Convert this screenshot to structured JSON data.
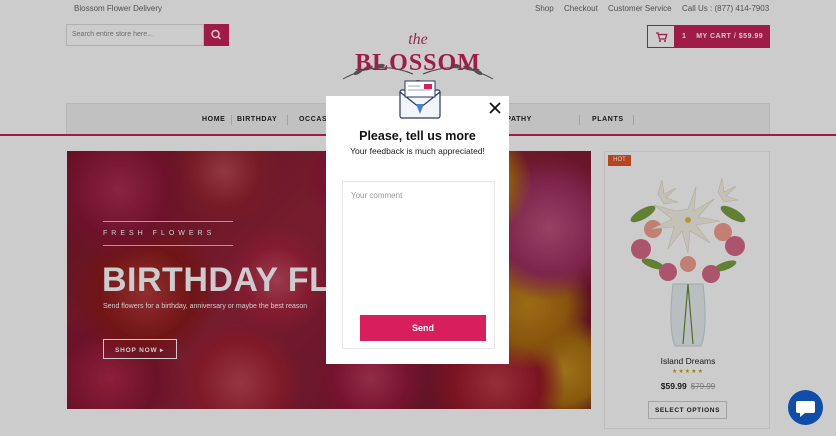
{
  "topbar": {
    "site_name": "Blossom Flower Delivery",
    "links": [
      "Shop",
      "Checkout",
      "Customer Service",
      "Call Us : (877) 414-7903"
    ]
  },
  "search": {
    "placeholder": "Search entire store here..."
  },
  "cart": {
    "count": "1",
    "label": "MY CART / $59.99"
  },
  "logo": {
    "top_word": "the",
    "main_word": "BLOSSOM"
  },
  "nav": {
    "items": [
      "HOME",
      "BIRTHDAY",
      "OCCASIONS",
      "FUNERAL & SYMPATHY",
      "PLANTS"
    ]
  },
  "hero": {
    "kicker": "FRESH FLOWERS",
    "headline": "BIRTHDAY FLOWERS",
    "subtitle": "Send flowers for a birthday, anniversary or maybe the best reason",
    "cta": "SHOP NOW"
  },
  "product": {
    "badge": "HOT",
    "name": "Island Dreams",
    "rating": 5,
    "price": "$59.99",
    "old_price": "$79.99",
    "button": "SELECT OPTIONS"
  },
  "modal": {
    "title": "Please, tell us more",
    "subtitle": "Your feedback is much appreciated!",
    "comment_placeholder": "Your comment",
    "comment_value": "",
    "send_label": "Send"
  },
  "colors": {
    "brand": "#c8235a",
    "send": "#d81f5d",
    "hot": "#e8542a",
    "chat": "#0f4da8"
  },
  "icons": [
    "cart-icon",
    "search-icon",
    "close-icon",
    "envelope-icon",
    "chat-icon",
    "caret-right-icon"
  ]
}
